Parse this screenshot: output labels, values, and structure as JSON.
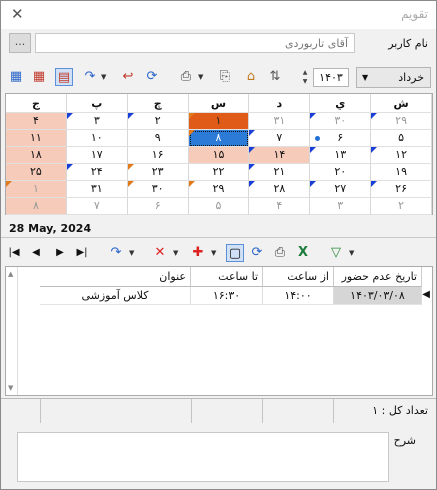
{
  "window": {
    "title": "تقویم"
  },
  "user": {
    "label": "نام کاربر",
    "value": "آقای تاربوردی",
    "browse_label": "..."
  },
  "toolbar": {
    "year": "۱۴۰۳",
    "month": "خرداد"
  },
  "calendar": {
    "days": [
      "ش",
      "ي",
      "د",
      "س",
      "چ",
      "پ",
      "ج"
    ],
    "weeks": [
      [
        {
          "t": "۲۹",
          "g": 1,
          "tri": "b"
        },
        {
          "t": "۳۰",
          "g": 1,
          "tri": "b"
        },
        {
          "t": "۳۱",
          "g": 1
        },
        {
          "t": "۱",
          "today": 1,
          "tri": "o"
        },
        {
          "t": "۲",
          "tri": "b"
        },
        {
          "t": "۳",
          "tri": "b"
        },
        {
          "t": "۴",
          "wk": 1
        }
      ],
      [
        {
          "t": "۵"
        },
        {
          "t": "۶",
          "dot": 1
        },
        {
          "t": "۷",
          "tri": "b"
        },
        {
          "t": "۸",
          "sel": 1,
          "tri": "o"
        },
        {
          "t": "۹"
        },
        {
          "t": "۱۰"
        },
        {
          "t": "۱۱",
          "wk": 1
        }
      ],
      [
        {
          "t": "۱۲",
          "tri": "b"
        },
        {
          "t": "۱۳",
          "tri": "b"
        },
        {
          "t": "۱۴",
          "wk": 1,
          "tri": "b"
        },
        {
          "t": "۱۵",
          "wk": 1
        },
        {
          "t": "۱۶"
        },
        {
          "t": "۱۷"
        },
        {
          "t": "۱۸",
          "wk": 1
        }
      ],
      [
        {
          "t": "۱۹"
        },
        {
          "t": "۲۰"
        },
        {
          "t": "۲۱",
          "tri": "b"
        },
        {
          "t": "۲۲"
        },
        {
          "t": "۲۳",
          "tri": "o"
        },
        {
          "t": "۲۴",
          "tri": "b"
        },
        {
          "t": "۲۵",
          "wk": 1
        }
      ],
      [
        {
          "t": "۲۶",
          "tri": "b"
        },
        {
          "t": "۲۷",
          "tri": "b"
        },
        {
          "t": "۲۸",
          "tri": "b"
        },
        {
          "t": "۲۹",
          "tri": "o"
        },
        {
          "t": "۳۰",
          "tri": "o"
        },
        {
          "t": "۳۱"
        },
        {
          "t": "۱",
          "wk": 1,
          "g": 1,
          "tri": "o"
        }
      ],
      [
        {
          "t": "۲",
          "g": 1
        },
        {
          "t": "۳",
          "g": 1
        },
        {
          "t": "۴",
          "g": 1
        },
        {
          "t": "۵",
          "g": 1
        },
        {
          "t": "۶",
          "g": 1
        },
        {
          "t": "۷",
          "g": 1
        },
        {
          "t": "۸",
          "wk": 1,
          "g": 1
        }
      ]
    ]
  },
  "selected_date": "28 May, 2024",
  "grid": {
    "columns": [
      "تاریخ عدم حضور",
      "از ساعت",
      "تا ساعت",
      "عنوان"
    ],
    "rows": [
      [
        "۱۴۰۳/۰۳/۰۸",
        "۱۴:۰۰",
        "۱۶:۳۰",
        "کلاس آموزشی"
      ]
    ]
  },
  "status": {
    "count_label": "تعداد کل : ۱"
  },
  "description": {
    "label": "شرح"
  },
  "colors": {
    "weekend": "#f6cbb9",
    "today": "#e05a18",
    "selected": "#2c7bd6"
  }
}
